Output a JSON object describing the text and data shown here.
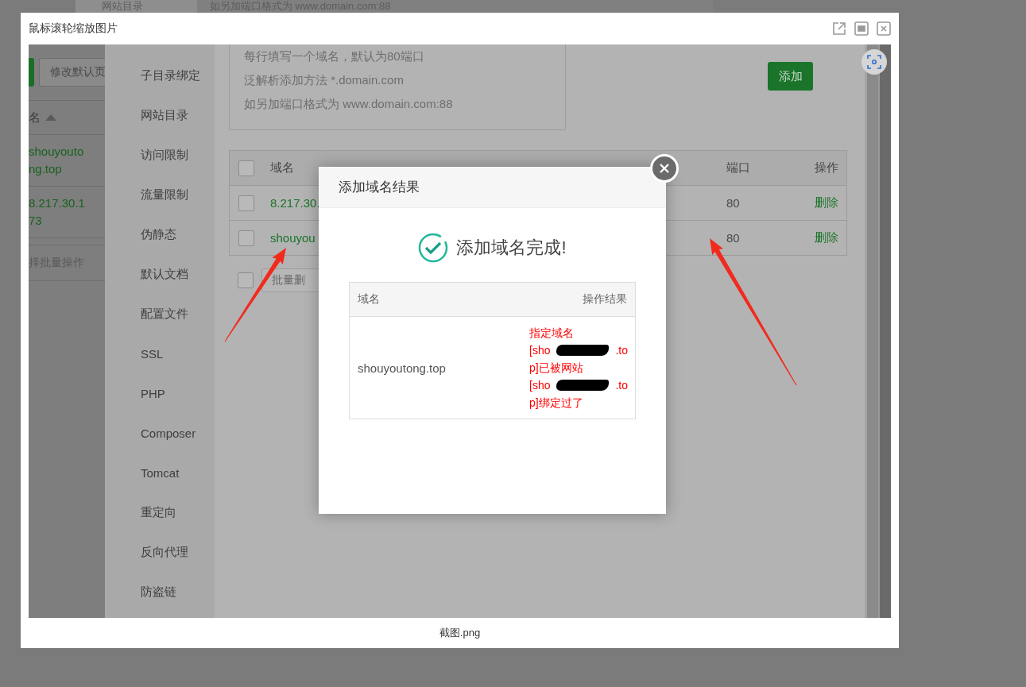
{
  "background_page": {
    "texts": [
      "网站目录",
      "如另加端口格式为 www.domain.com:88"
    ]
  },
  "viewer": {
    "title": "鼠标滚轮缩放图片",
    "caption": "截图.png",
    "screenshot": {
      "left_panel": {
        "button": "修改默认页",
        "column_header": "名",
        "rows": [
          [
            "shouyouto",
            "ng.top"
          ],
          [
            "8.217.30.1",
            "73"
          ]
        ],
        "batch_select": "择批量操作"
      },
      "sidebar": {
        "items": [
          "子目录绑定",
          "网站目录",
          "访问限制",
          "流量限制",
          "伪静态",
          "默认文档",
          "配置文件",
          "SSL",
          "PHP",
          "Composer",
          "Tomcat",
          "重定向",
          "反向代理",
          "防盗链"
        ]
      },
      "domain_input": {
        "hint_lines": [
          "每行填写一个域名，默认为80端口",
          "泛解析添加方法 *.domain.com",
          "如另加端口格式为 www.domain.com:88"
        ]
      },
      "add_button": "添加",
      "table": {
        "checked": false,
        "columns": [
          "域名",
          "端口",
          "操作"
        ],
        "rows": [
          {
            "checked": false,
            "domain": "8.217.30.",
            "port": "80",
            "action": "删除"
          },
          {
            "checked": false,
            "domain": "shouyou",
            "port": "80",
            "action": "删除"
          }
        ]
      },
      "batch": {
        "checked": false,
        "button": "批量删"
      },
      "dialog": {
        "title": "添加域名结果",
        "message": "添加域名完成!",
        "columns": [
          "域名",
          "操作结果"
        ],
        "rows": [
          {
            "domain": "shouyoutong.top",
            "result": [
              {
                "kind": "text",
                "text": "指定域名"
              },
              {
                "kind": "redacted",
                "before": "[sho",
                "after": ".to"
              },
              {
                "kind": "text",
                "text": "p]已被网站"
              },
              {
                "kind": "redacted",
                "before": "[sho",
                "after": ".to"
              },
              {
                "kind": "text",
                "text": "p]绑定过了"
              }
            ]
          }
        ]
      }
    }
  }
}
